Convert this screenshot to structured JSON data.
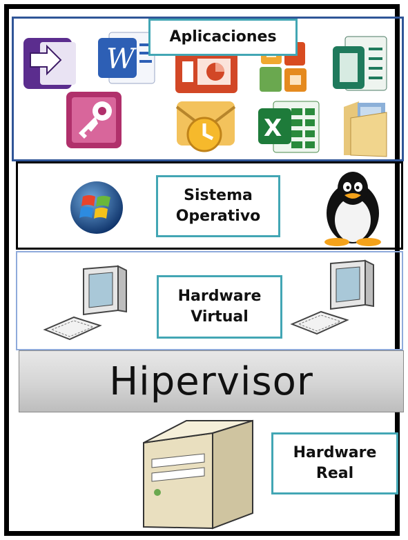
{
  "labels": {
    "apps": "Aplicaciones",
    "os_line1": "Sistema",
    "os_line2": "Operativo",
    "vhw_line1": "Hardware",
    "vhw_line2": "Virtual",
    "hypervisor": "Hipervisor",
    "rhw_line1": "Hardware",
    "rhw_line2": "Real"
  },
  "icons": [
    "infopath-icon",
    "word-icon",
    "powerpoint-icon",
    "office-logo-icon",
    "publisher-icon",
    "access-icon",
    "outlook-icon",
    "excel-icon",
    "folder-icon",
    "windows-logo-icon",
    "tux-penguin-icon",
    "computer-icon",
    "server-tower-icon"
  ],
  "colors": {
    "label_border": "#42a6b4",
    "apps_border": "#2f5597",
    "vhw_border": "#8eaadb"
  }
}
